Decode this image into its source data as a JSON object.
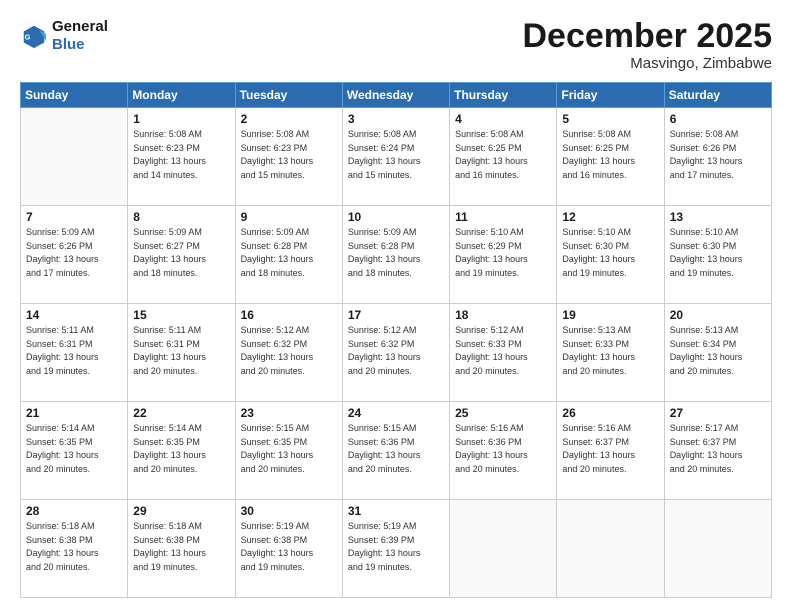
{
  "logo": {
    "line1": "General",
    "line2": "Blue"
  },
  "title": "December 2025",
  "location": "Masvingo, Zimbabwe",
  "days_header": [
    "Sunday",
    "Monday",
    "Tuesday",
    "Wednesday",
    "Thursday",
    "Friday",
    "Saturday"
  ],
  "weeks": [
    [
      {
        "num": "",
        "info": ""
      },
      {
        "num": "1",
        "info": "Sunrise: 5:08 AM\nSunset: 6:23 PM\nDaylight: 13 hours\nand 14 minutes."
      },
      {
        "num": "2",
        "info": "Sunrise: 5:08 AM\nSunset: 6:23 PM\nDaylight: 13 hours\nand 15 minutes."
      },
      {
        "num": "3",
        "info": "Sunrise: 5:08 AM\nSunset: 6:24 PM\nDaylight: 13 hours\nand 15 minutes."
      },
      {
        "num": "4",
        "info": "Sunrise: 5:08 AM\nSunset: 6:25 PM\nDaylight: 13 hours\nand 16 minutes."
      },
      {
        "num": "5",
        "info": "Sunrise: 5:08 AM\nSunset: 6:25 PM\nDaylight: 13 hours\nand 16 minutes."
      },
      {
        "num": "6",
        "info": "Sunrise: 5:08 AM\nSunset: 6:26 PM\nDaylight: 13 hours\nand 17 minutes."
      }
    ],
    [
      {
        "num": "7",
        "info": "Sunrise: 5:09 AM\nSunset: 6:26 PM\nDaylight: 13 hours\nand 17 minutes."
      },
      {
        "num": "8",
        "info": "Sunrise: 5:09 AM\nSunset: 6:27 PM\nDaylight: 13 hours\nand 18 minutes."
      },
      {
        "num": "9",
        "info": "Sunrise: 5:09 AM\nSunset: 6:28 PM\nDaylight: 13 hours\nand 18 minutes."
      },
      {
        "num": "10",
        "info": "Sunrise: 5:09 AM\nSunset: 6:28 PM\nDaylight: 13 hours\nand 18 minutes."
      },
      {
        "num": "11",
        "info": "Sunrise: 5:10 AM\nSunset: 6:29 PM\nDaylight: 13 hours\nand 19 minutes."
      },
      {
        "num": "12",
        "info": "Sunrise: 5:10 AM\nSunset: 6:30 PM\nDaylight: 13 hours\nand 19 minutes."
      },
      {
        "num": "13",
        "info": "Sunrise: 5:10 AM\nSunset: 6:30 PM\nDaylight: 13 hours\nand 19 minutes."
      }
    ],
    [
      {
        "num": "14",
        "info": "Sunrise: 5:11 AM\nSunset: 6:31 PM\nDaylight: 13 hours\nand 19 minutes."
      },
      {
        "num": "15",
        "info": "Sunrise: 5:11 AM\nSunset: 6:31 PM\nDaylight: 13 hours\nand 20 minutes."
      },
      {
        "num": "16",
        "info": "Sunrise: 5:12 AM\nSunset: 6:32 PM\nDaylight: 13 hours\nand 20 minutes."
      },
      {
        "num": "17",
        "info": "Sunrise: 5:12 AM\nSunset: 6:32 PM\nDaylight: 13 hours\nand 20 minutes."
      },
      {
        "num": "18",
        "info": "Sunrise: 5:12 AM\nSunset: 6:33 PM\nDaylight: 13 hours\nand 20 minutes."
      },
      {
        "num": "19",
        "info": "Sunrise: 5:13 AM\nSunset: 6:33 PM\nDaylight: 13 hours\nand 20 minutes."
      },
      {
        "num": "20",
        "info": "Sunrise: 5:13 AM\nSunset: 6:34 PM\nDaylight: 13 hours\nand 20 minutes."
      }
    ],
    [
      {
        "num": "21",
        "info": "Sunrise: 5:14 AM\nSunset: 6:35 PM\nDaylight: 13 hours\nand 20 minutes."
      },
      {
        "num": "22",
        "info": "Sunrise: 5:14 AM\nSunset: 6:35 PM\nDaylight: 13 hours\nand 20 minutes."
      },
      {
        "num": "23",
        "info": "Sunrise: 5:15 AM\nSunset: 6:35 PM\nDaylight: 13 hours\nand 20 minutes."
      },
      {
        "num": "24",
        "info": "Sunrise: 5:15 AM\nSunset: 6:36 PM\nDaylight: 13 hours\nand 20 minutes."
      },
      {
        "num": "25",
        "info": "Sunrise: 5:16 AM\nSunset: 6:36 PM\nDaylight: 13 hours\nand 20 minutes."
      },
      {
        "num": "26",
        "info": "Sunrise: 5:16 AM\nSunset: 6:37 PM\nDaylight: 13 hours\nand 20 minutes."
      },
      {
        "num": "27",
        "info": "Sunrise: 5:17 AM\nSunset: 6:37 PM\nDaylight: 13 hours\nand 20 minutes."
      }
    ],
    [
      {
        "num": "28",
        "info": "Sunrise: 5:18 AM\nSunset: 6:38 PM\nDaylight: 13 hours\nand 20 minutes."
      },
      {
        "num": "29",
        "info": "Sunrise: 5:18 AM\nSunset: 6:38 PM\nDaylight: 13 hours\nand 19 minutes."
      },
      {
        "num": "30",
        "info": "Sunrise: 5:19 AM\nSunset: 6:38 PM\nDaylight: 13 hours\nand 19 minutes."
      },
      {
        "num": "31",
        "info": "Sunrise: 5:19 AM\nSunset: 6:39 PM\nDaylight: 13 hours\nand 19 minutes."
      },
      {
        "num": "",
        "info": ""
      },
      {
        "num": "",
        "info": ""
      },
      {
        "num": "",
        "info": ""
      }
    ]
  ]
}
